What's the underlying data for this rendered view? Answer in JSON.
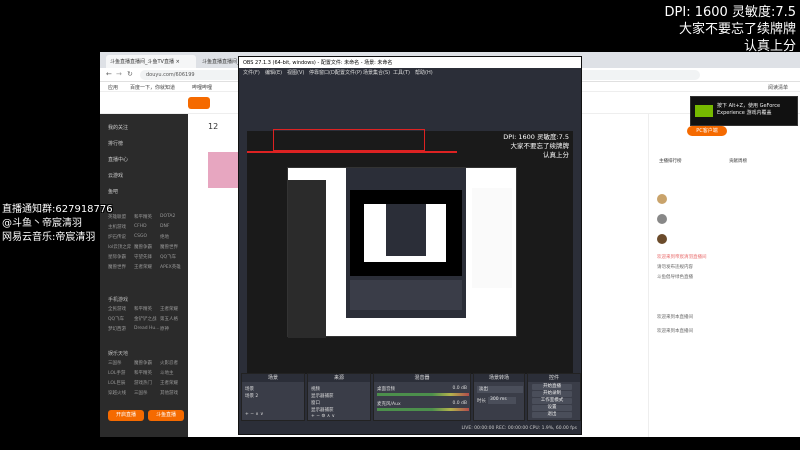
{
  "overlay": {
    "line1": "DPI: 1600 灵敏度:7.5",
    "line2": "大家不要忘了续牌牌",
    "line3": "认真上分"
  },
  "left_overlay": {
    "line1": "直播通知群:627918776",
    "line2": "@斗鱼丶帝宸清羽",
    "line3": "网易云音乐:帝宸清羽"
  },
  "browser": {
    "tab1": "斗鱼直播直播间_斗鱼TV直播 ×",
    "tab2": "斗鱼直播直播间_斗...",
    "url": "douyu.com/606199",
    "bookmarks": [
      "应用",
      "百度一下，你就知道",
      "哔哩哔哩"
    ],
    "reading_list": "阅读清单",
    "sidebar_items": [
      "我的关注",
      "排行榜",
      "直播中心",
      "云游戏",
      "鱼吧"
    ],
    "sidebar_grid": [
      [
        "英雄联盟",
        "和平精英",
        "DOTA2"
      ],
      [
        "主机游戏",
        "CFHD",
        "DNF"
      ],
      [
        "炉石传说",
        "CSGO",
        "绝地"
      ],
      [
        "lol云顶之弈",
        "魔兽争霸",
        "魔兽世界"
      ],
      [
        "星际争霸",
        "守望先锋",
        "QQ飞车"
      ],
      [
        "魔兽世界",
        "王者荣耀",
        "APEX英雄"
      ]
    ],
    "sidebar_head2": "手机游戏",
    "sidebar_grid2": [
      [
        "全民游戏",
        "和平精英",
        "王者荣耀"
      ],
      [
        "QQ飞车",
        "金铲铲之战",
        "第五人格"
      ],
      [
        "梦幻西游",
        "Dread Hu...",
        "原神"
      ]
    ],
    "sidebar_head3": "娱乐天地",
    "sidebar_grid3": [
      [
        "三国杀",
        "魔兽争霸",
        "火影忍者"
      ],
      [
        "LOL手游",
        "和平精英",
        "斗地主"
      ],
      [
        "LOL巨辰",
        "游戏热门",
        "王者荣耀"
      ],
      [
        "穿越火线",
        "三国杀",
        "其他游戏"
      ]
    ],
    "btn_open": "开启直播",
    "btn_download": "斗鱼直播",
    "notice": "按下 Alt+Z，使用 GeForce Experience 游戏内覆盖",
    "rank_tab1": "主播排行榜",
    "rank_tab2": "贡献周榜",
    "chat_texts": [
      "欢迎来到帝宸清羽直播间",
      "请勿发布违规内容",
      "斗鱼倡导绿色直播",
      "欢迎来到本直播间",
      "欢迎来到本直播间"
    ],
    "pc_client": "PC客户端"
  },
  "obs": {
    "title": "OBS 27.1.3 (64-bit, windows) - 配置文件: 未命名 - 场景: 未命名",
    "menu": [
      "文件(F)",
      "编辑(E)",
      "视图(V)",
      "停靠窗口(D)",
      "配置文件(P)",
      "场景集合(S)",
      "工具(T)",
      "帮助(H)"
    ],
    "docks": {
      "scenes": "场景",
      "sources": "来源",
      "mixer": "混音器",
      "transitions": "场景转场",
      "controls": "控件"
    },
    "scene_items": [
      "场景",
      "场景 2"
    ],
    "source_items": [
      "视频",
      "显示器捕获",
      "窗口",
      "显示器捕获"
    ],
    "mixer_items": [
      "桌面音频",
      "麦克风/Aux"
    ],
    "mixer_db": "0.0 dB",
    "transition_name": "淡出",
    "duration_label": "时长",
    "duration_value": "300 ms",
    "control_buttons": [
      "开始直播",
      "开始录制",
      "工作室模式",
      "设置",
      "退出"
    ],
    "status": "LIVE: 00:00:00   REC: 00:00:00   CPU: 1.9%, 60.00 fps"
  }
}
